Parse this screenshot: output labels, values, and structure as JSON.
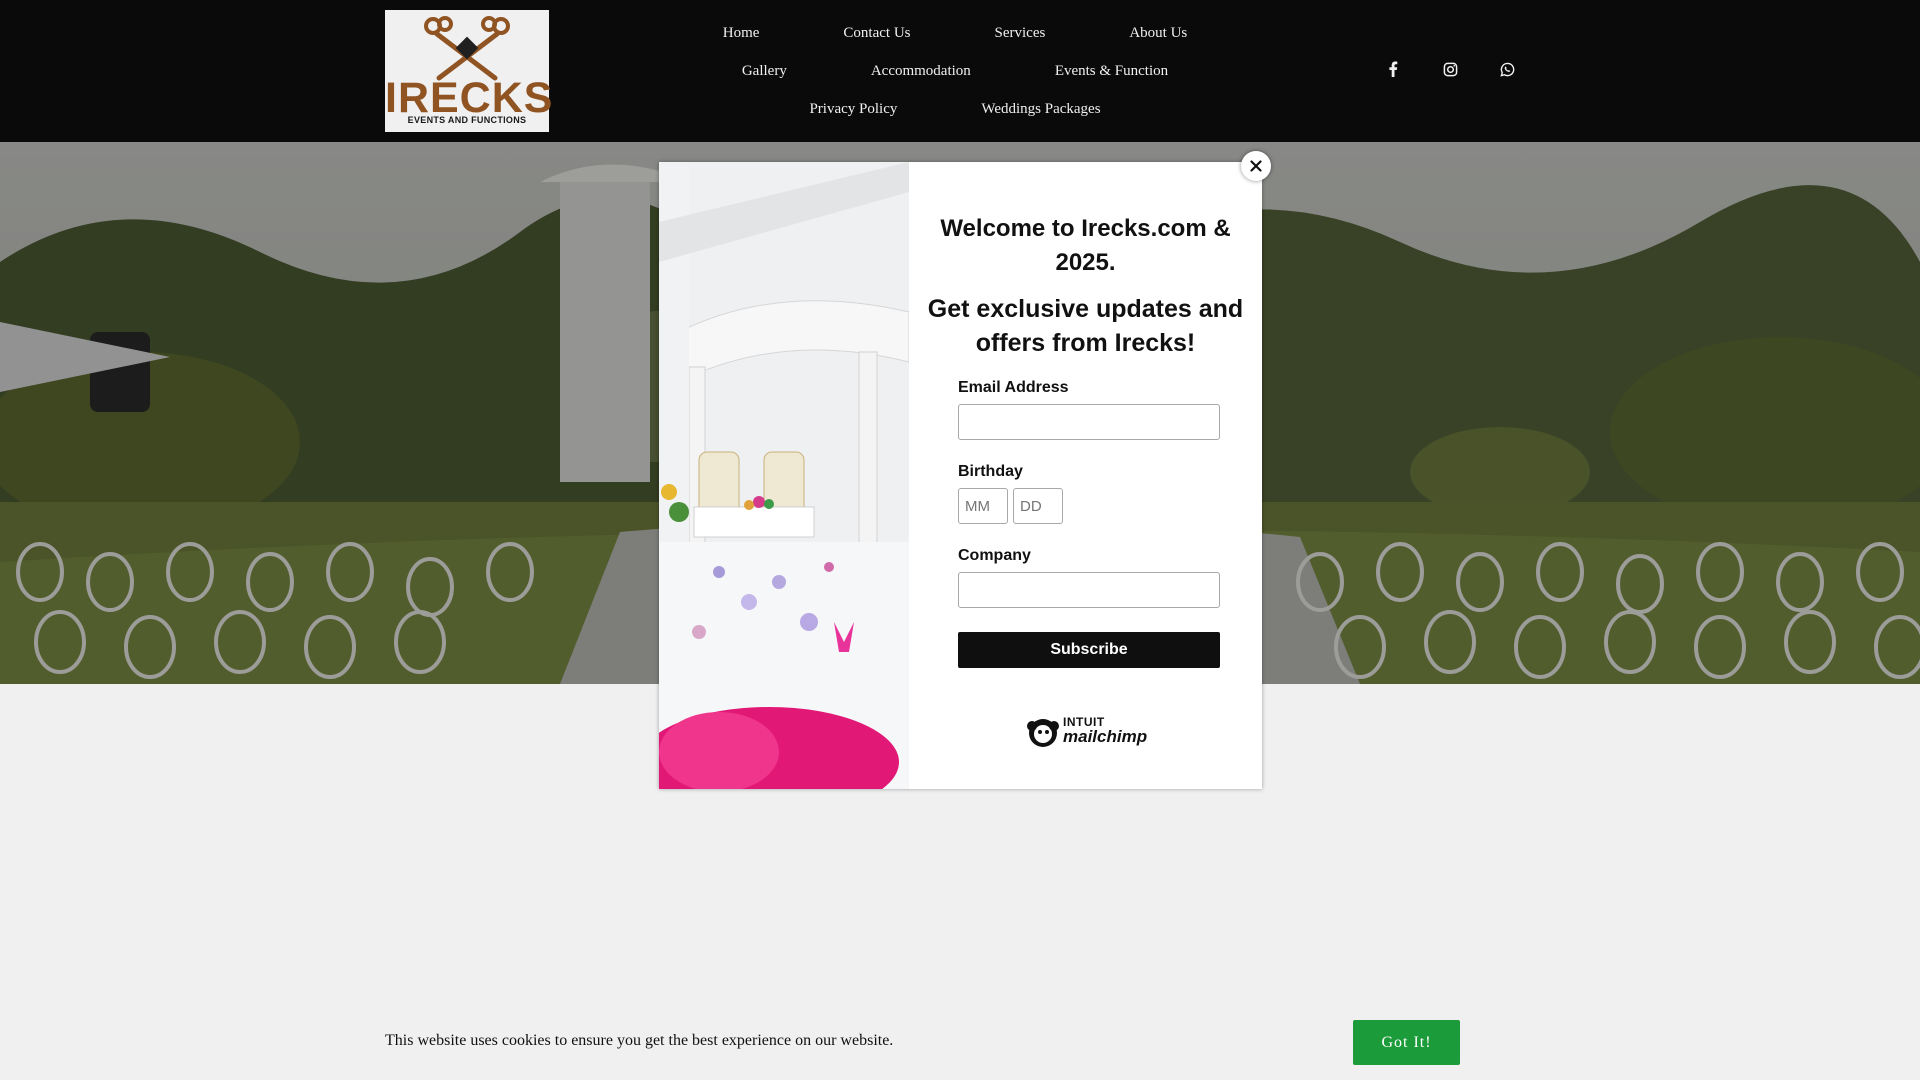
{
  "logo": {
    "brand": "IRECKS",
    "tagline": "EVENTS AND FUNCTIONS",
    "icon": "crossed-keys-icon",
    "color": "#9a5a26"
  },
  "nav": {
    "row1": [
      "Home",
      "Contact Us",
      "Services",
      "About Us"
    ],
    "row2": [
      "Gallery",
      "Accommodation",
      "Events & Function"
    ],
    "row3": [
      "Privacy Policy",
      "Weddings Packages"
    ]
  },
  "social": [
    "facebook-icon",
    "instagram-icon",
    "whatsapp-icon"
  ],
  "popup": {
    "welcome": "Welcome to Irecks.com & 2025.",
    "offers": "Get exclusive updates and offers from Irecks!",
    "email_label": "Email Address",
    "email_value": "",
    "birthday_label": "Birthday",
    "month_placeholder": "MM",
    "day_placeholder": "DD",
    "company_label": "Company",
    "company_value": "",
    "subscribe": "Subscribe",
    "provider_top": "INTUIT",
    "provider_name": "mailchimp"
  },
  "cookie": {
    "text": "This website uses cookies to ensure you get the best experience on our website.",
    "button": "Got It!",
    "button_color": "#1c9b3b"
  }
}
